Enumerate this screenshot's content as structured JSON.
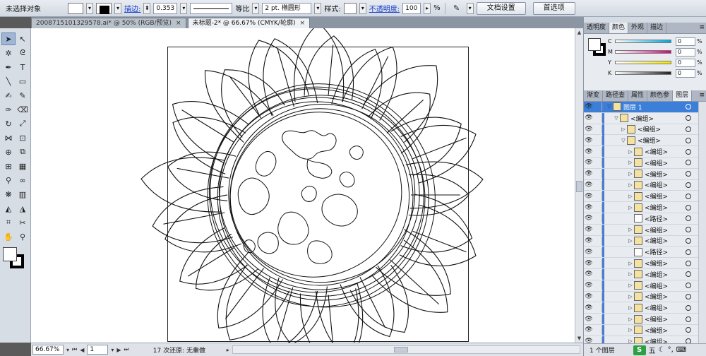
{
  "control_bar": {
    "selection_status": "未选择对象",
    "stroke_link": "描边:",
    "stroke_weight": "0.353",
    "profile_label": "等比",
    "brush_label": "2 pt. 椭圆形",
    "style_label": "样式:",
    "opacity_link": "不透明度:",
    "opacity_value": "100",
    "opacity_unit": "%",
    "doc_setup_button": "文档设置",
    "prefs_button": "首选项"
  },
  "tabs": [
    {
      "label": "2008715101329578.ai* @ 50% (RGB/预览)",
      "close": "×"
    },
    {
      "label": "未标题-2* @ 66.67% (CMYK/轮廓)",
      "close": "×"
    }
  ],
  "status_bar": {
    "zoom": "66.67%",
    "page": "1",
    "undo_status": "17 次还原: 无重做"
  },
  "color_panel": {
    "tabs": [
      "透明度",
      "颜色",
      "外观",
      "描边"
    ],
    "active_tab": "颜色",
    "channels": [
      {
        "label": "C",
        "value": "0",
        "unit": "%",
        "color": "#00a6e0"
      },
      {
        "label": "M",
        "value": "0",
        "unit": "%",
        "color": "#e0007a"
      },
      {
        "label": "Y",
        "value": "0",
        "unit": "%",
        "color": "#f4e400"
      },
      {
        "label": "K",
        "value": "0",
        "unit": "%",
        "color": "#222222"
      }
    ]
  },
  "layers_panel": {
    "tabs": [
      "渐变",
      "路径查",
      "属性",
      "颜色参",
      "图层"
    ],
    "active_tab": "图层",
    "rows": [
      {
        "name": "图层 1",
        "indent": 0,
        "expand": "▽",
        "top": true
      },
      {
        "name": "<编组>",
        "indent": 1,
        "expand": "▽"
      },
      {
        "name": "<编组>",
        "indent": 2,
        "expand": "▷"
      },
      {
        "name": "<编组>",
        "indent": 2,
        "expand": "▽"
      },
      {
        "name": "<编组>",
        "indent": 3,
        "expand": "▷"
      },
      {
        "name": "<编组>",
        "indent": 3,
        "expand": "▷"
      },
      {
        "name": "<编组>",
        "indent": 3,
        "expand": "▷"
      },
      {
        "name": "<编组>",
        "indent": 3,
        "expand": "▷"
      },
      {
        "name": "<编组>",
        "indent": 3,
        "expand": "▷"
      },
      {
        "name": "<编组>",
        "indent": 3,
        "expand": "▷"
      },
      {
        "name": "<路径>",
        "indent": 3,
        "expand": "",
        "path": true
      },
      {
        "name": "<编组>",
        "indent": 3,
        "expand": "▷"
      },
      {
        "name": "<编组>",
        "indent": 3,
        "expand": "▷"
      },
      {
        "name": "<路径>",
        "indent": 3,
        "expand": "",
        "path": true
      },
      {
        "name": "<编组>",
        "indent": 3,
        "expand": "▷"
      },
      {
        "name": "<编组>",
        "indent": 3,
        "expand": "▷"
      },
      {
        "name": "<编组>",
        "indent": 3,
        "expand": "▷"
      },
      {
        "name": "<编组>",
        "indent": 3,
        "expand": "▷"
      },
      {
        "name": "<编组>",
        "indent": 3,
        "expand": "▷"
      },
      {
        "name": "<编组>",
        "indent": 3,
        "expand": "▷"
      },
      {
        "name": "<编组>",
        "indent": 3,
        "expand": "▷"
      },
      {
        "name": "<编组>",
        "indent": 3,
        "expand": "▷"
      }
    ],
    "footer": "1 个图层"
  },
  "ime": {
    "logo": "S",
    "mode": "五"
  }
}
